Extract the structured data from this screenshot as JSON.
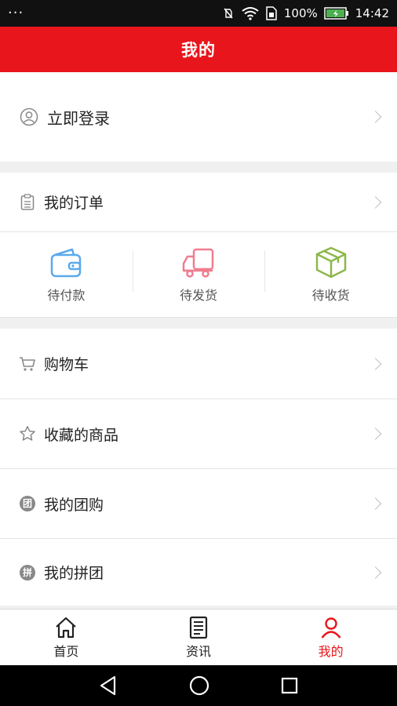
{
  "status_bar": {
    "menu_dots": "···",
    "battery": "100%",
    "time": "14:42"
  },
  "header": {
    "title": "我的"
  },
  "login": {
    "label": "立即登录"
  },
  "orders": {
    "label": "我的订单",
    "items": [
      {
        "label": "待付款",
        "icon": "wallet-icon"
      },
      {
        "label": "待发货",
        "icon": "truck-icon"
      },
      {
        "label": "待收货",
        "icon": "package-icon"
      }
    ]
  },
  "menu": [
    {
      "label": "购物车",
      "icon": "cart-icon"
    },
    {
      "label": "收藏的商品",
      "icon": "star-icon"
    },
    {
      "label": "我的团购",
      "icon": "group-buy-icon",
      "badge": "团"
    },
    {
      "label": "我的拼团",
      "icon": "group-deal-icon",
      "badge": "拼"
    }
  ],
  "tabs": [
    {
      "label": "首页",
      "icon": "home-icon"
    },
    {
      "label": "资讯",
      "icon": "news-icon"
    },
    {
      "label": "我的",
      "icon": "user-icon",
      "active": true
    }
  ],
  "colors": {
    "brand": "#e8161c",
    "wallet": "#5aa9ec",
    "truck": "#f07d8f",
    "package": "#8cb84a"
  }
}
